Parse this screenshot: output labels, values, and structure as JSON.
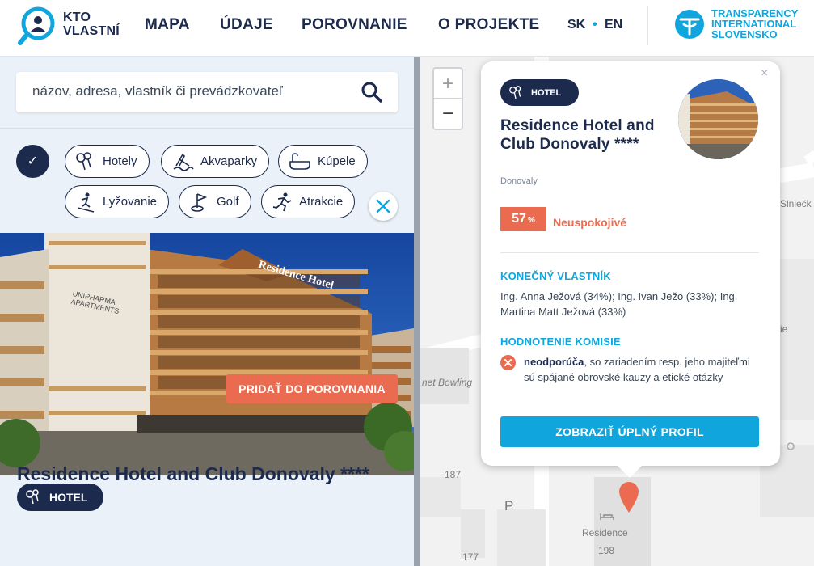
{
  "header": {
    "logo_line1": "KTO",
    "logo_line2": "VLASTNÍ",
    "nav": [
      "MAPA",
      "ÚDAJE",
      "POROVNANIE",
      "O PROJEKTE"
    ],
    "lang_sk": "SK",
    "lang_sep": "•",
    "lang_en": "EN",
    "partner": [
      "TRANSPARENCY",
      "INTERNATIONAL",
      "SLOVENSKO"
    ]
  },
  "search": {
    "placeholder": "názov, adresa, vlastník či prevádzkovateľ"
  },
  "filters": {
    "all_check": "✓",
    "chips": [
      "Hotely",
      "Akvaparky",
      "Kúpele",
      "Lyžovanie",
      "Golf",
      "Atrakcie"
    ]
  },
  "detail": {
    "compare_button": "PRIDAŤ DO POROVNANIA",
    "category": "HOTEL",
    "title": "Residence Hotel and Club Donovaly ****",
    "photo_sign": "Residence Hotel",
    "photo_sign2": "UNIPHARMA APARTMENTS"
  },
  "map": {
    "zoom_in": "+",
    "zoom_out": "−",
    "labels": {
      "street": "Slniečk",
      "bowling": "net Bowling",
      "n187": "187",
      "n177": "177",
      "n198": "198",
      "residence": "Residence",
      "parking": "P",
      "partial": "ie"
    }
  },
  "popup": {
    "category": "HOTEL",
    "title": "Residence Hotel and Club Donovaly ****",
    "location": "Donovaly",
    "score": "57",
    "score_unit": "%",
    "score_label": "Neuspokojivé",
    "owner_heading": "KONEČNÝ VLASTNÍK",
    "owners": "Ing. Anna Ježová (34%); Ing. Ivan Ježo (33%); Ing. Martina Matt Ježová (33%)",
    "eval_heading": "HODNOTENIE KOMISIE",
    "eval_strong": "neodporúča",
    "eval_rest": ", so zariadením resp. jeho majiteľmi sú spájané obrovské kauzy a etické otázky",
    "profile_button": "ZOBRAZIŤ ÚPLNÝ PROFIL",
    "close": "×"
  },
  "colors": {
    "navy": "#1c2a4d",
    "accent_blue": "#10a5dc",
    "score_red": "#ea6b4f",
    "sidebar_bg": "#eaf1f8"
  }
}
